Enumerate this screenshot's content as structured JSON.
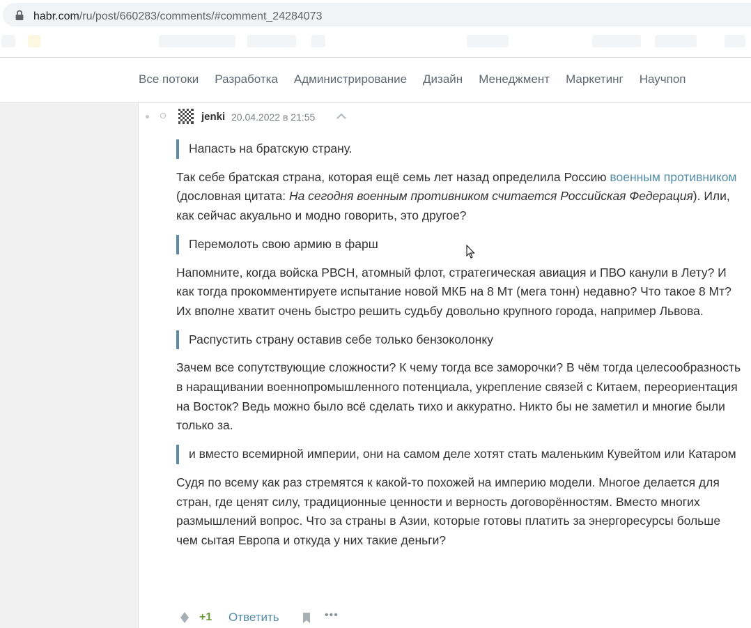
{
  "browser": {
    "url_host": "habr.com",
    "url_path": "/ru/post/660283/comments/#comment_24284073"
  },
  "nav": {
    "items": [
      "Все потоки",
      "Разработка",
      "Администрирование",
      "Дизайн",
      "Менеджмент",
      "Маркетинг",
      "Научпоп"
    ]
  },
  "comment": {
    "author": "jenki",
    "date": "20.04.2022 в 21:55",
    "blocks": [
      {
        "type": "quote",
        "text": "Напасть на братскую страну."
      },
      {
        "type": "para",
        "parts": [
          {
            "t": "Так себе братская страна, которая ещё семь лет назад определила Россию "
          },
          {
            "t": "военным противником",
            "link": true
          },
          {
            "t": " (дословная цитата: "
          },
          {
            "t": "На сегодня военным противником считается Российская Федерация",
            "italic": true
          },
          {
            "t": "). Или, как сейчас акуально и модно говорить, это другое?"
          }
        ]
      },
      {
        "type": "quote",
        "text": "Перемолоть свою армию в фарш"
      },
      {
        "type": "para",
        "parts": [
          {
            "t": "Напомните, когда войска РВСН, атомный флот, стратегическая авиация и ПВО канули в Лету? И как тогда прокомментируете испытание новой МКБ на 8 Мт (мега тонн) недавно? Что такое 8 Мт? Их вполне хватит очень быстро решить судьбу довольно крупного города, например Львова."
          }
        ]
      },
      {
        "type": "quote",
        "text": "Распустить страну оставив себе только бензоколонку"
      },
      {
        "type": "para",
        "parts": [
          {
            "t": "Зачем все сопутствующие сложности? К чему тогда все заморочки? В чём тогда целесообразность в наращивании военнопромышленного потенциала, укрепление связей с Китаем, переориентация на Восток? Ведь можно было всё сделать тихо и аккуратно. Никто бы не заметил и многие были только за."
          }
        ]
      },
      {
        "type": "quote",
        "text": "и вместо всемирной империи, они на самом деле хотят стать маленьким Кувейтом или Катаром"
      },
      {
        "type": "para",
        "parts": [
          {
            "t": "Судя по всему как раз стремятся к какой-то похожей на империю модели. Многое делается для стран, где ценят силу, традиционные ценности и верность договорённостям. Вместо многих размышлений вопрос. Что за страны в Азии, которые готовы платить за энергоресурсы больше чем сытая Европа и откуда у них такие деньги?"
          }
        ]
      }
    ],
    "score": "+1",
    "reply_label": "Ответить",
    "more_label": "•••"
  },
  "colors": {
    "link": "#548eaa",
    "quote_bar": "#5e8aa6",
    "score": "#6c9a3c",
    "gutter": "#f0f0f0"
  }
}
